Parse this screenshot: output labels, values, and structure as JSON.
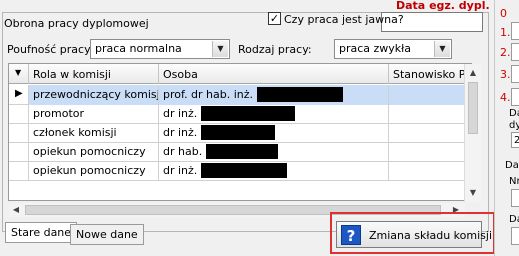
{
  "header": {
    "group_title": "Obrona pracy dyplomowej",
    "data_egz_label": "Data egz. dypl.",
    "jawna_label": "Czy praca jest jawna?",
    "jawna_checked": "✓"
  },
  "filters": {
    "poufnosc_label": "Poufność pracy:",
    "poufnosc_value": "praca normalna",
    "rodzaj_label": "Rodzaj pracy:",
    "rodzaj_value": "praca zwykła"
  },
  "grid": {
    "columns": [
      "Rola w komisji",
      "Osoba",
      "Stanowisko PŁ"
    ],
    "rows": [
      {
        "role": "przewodniczący komisji",
        "person": "prof. dr hab. inż."
      },
      {
        "role": "promotor",
        "person": "dr inż."
      },
      {
        "role": "członek komisji",
        "person": "dr inż."
      },
      {
        "role": "opiekun pomocniczy",
        "person": "dr hab."
      },
      {
        "role": "opiekun pomocniczy",
        "person": "dr inż."
      }
    ]
  },
  "tabs": {
    "stare": "Stare dane",
    "nowe": "Nowe dane"
  },
  "button": {
    "zmiana": "Zmiana składu komisji",
    "help_glyph": "?"
  },
  "right_panel": {
    "nums": [
      "0",
      "1.",
      "2.",
      "3.",
      "4."
    ],
    "frag1": "Da",
    "frag2": "dy",
    "frag3": "2",
    "frag4": "Dar",
    "frag5": "Nr",
    "frag6": "Da"
  }
}
